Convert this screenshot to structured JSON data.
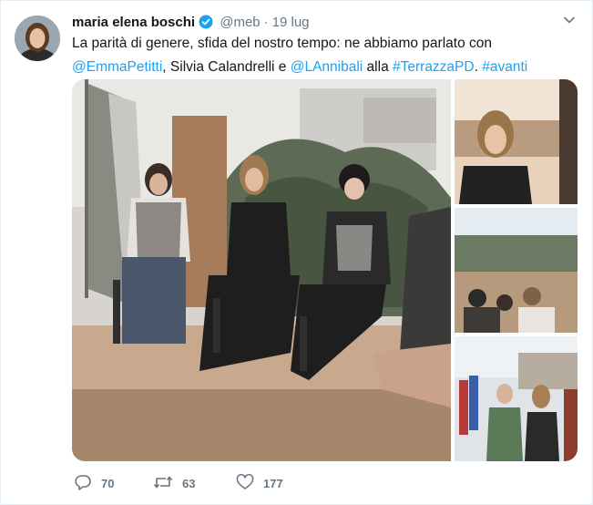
{
  "tweet": {
    "author_name": "maria elena boschi",
    "handle": "@meb",
    "separator": "·",
    "date": "19 lug",
    "text": {
      "part1": "La parità di genere, sfida del nostro tempo: ne abbiamo parlato con",
      "mention1": "@EmmaPetitti",
      "part2": ", Silvia Calandrelli e ",
      "mention2": "@LAnnibali",
      "part3": " alla ",
      "hashtag1": "#TerrazzaPD",
      "part4": ". ",
      "hashtag2": "#avanti"
    },
    "media_images": [
      "panel-discussion-photo",
      "speaker-closeup-photo",
      "terrace-audience-photo",
      "group-conversation-photo"
    ]
  },
  "actions": {
    "replies": "70",
    "retweets": "63",
    "likes": "177"
  },
  "icons": [
    "verified-badge-icon",
    "chevron-down-icon",
    "reply-icon",
    "retweet-icon",
    "like-icon"
  ],
  "colors": {
    "link": "#1da1f2",
    "muted": "#657786",
    "text": "#14171a",
    "border": "#e6ecf0"
  }
}
